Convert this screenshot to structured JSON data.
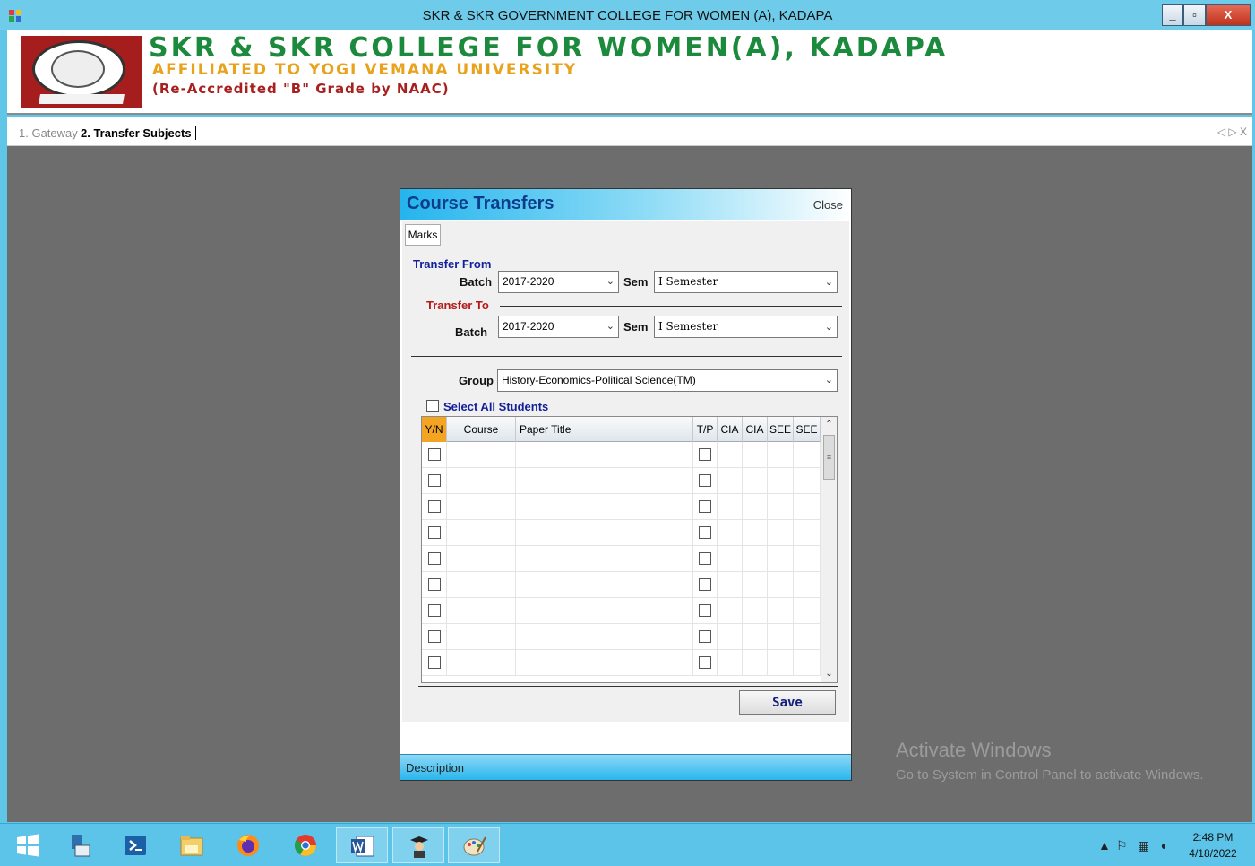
{
  "window": {
    "title": "SKR & SKR GOVERNMENT COLLEGE FOR WOMEN (A), KADAPA",
    "min_label": "_",
    "max_label": "▫",
    "close_label": "X"
  },
  "banner": {
    "college_name": "SKR & SKR COLLEGE FOR WOMEN(A), KADAPA",
    "affiliated": "AFFILIATED TO YOGI VEMANA UNIVERSITY",
    "accredited": "(Re-Accredited \"B\" Grade by NAAC)"
  },
  "tabs": {
    "items": [
      {
        "label": "1. Gateway"
      },
      {
        "label": "2. Transfer Subjects"
      }
    ],
    "nav": "◁ ▷ X"
  },
  "dialog": {
    "title": "Course Transfers",
    "close_label": "Close",
    "tab_label": "Marks",
    "transfer_from": {
      "label": "Transfer From",
      "batch_label": "Batch",
      "batch_value": "2017-2020",
      "sem_label": "Sem",
      "sem_value": "I Semester"
    },
    "transfer_to": {
      "label": "Transfer To",
      "batch_label": "Batch",
      "batch_value": "2017-2020",
      "sem_label": "Sem",
      "sem_value": "I Semester"
    },
    "group": {
      "label": "Group",
      "value": "History-Economics-Political Science(TM)"
    },
    "select_all_label": "Select All Students",
    "grid": {
      "columns": [
        "Y/N",
        "Course",
        "Paper Title",
        "T/P",
        "CIA",
        "CIA",
        "SEE",
        "SEE"
      ],
      "row_count": 9
    },
    "save_label": "Save",
    "description_label": "Description"
  },
  "watermark": {
    "line1": "Activate Windows",
    "line2": "Go to System in Control Panel to activate Windows."
  },
  "taskbar": {
    "time": "2:48 PM",
    "date": "4/18/2022"
  },
  "colors": {
    "accent": "#5cc4e8",
    "dialog_title": "#0b3e8a",
    "transfer_from": "#13209a",
    "transfer_to": "#b31a1a",
    "yn_header": "#f3a422"
  }
}
